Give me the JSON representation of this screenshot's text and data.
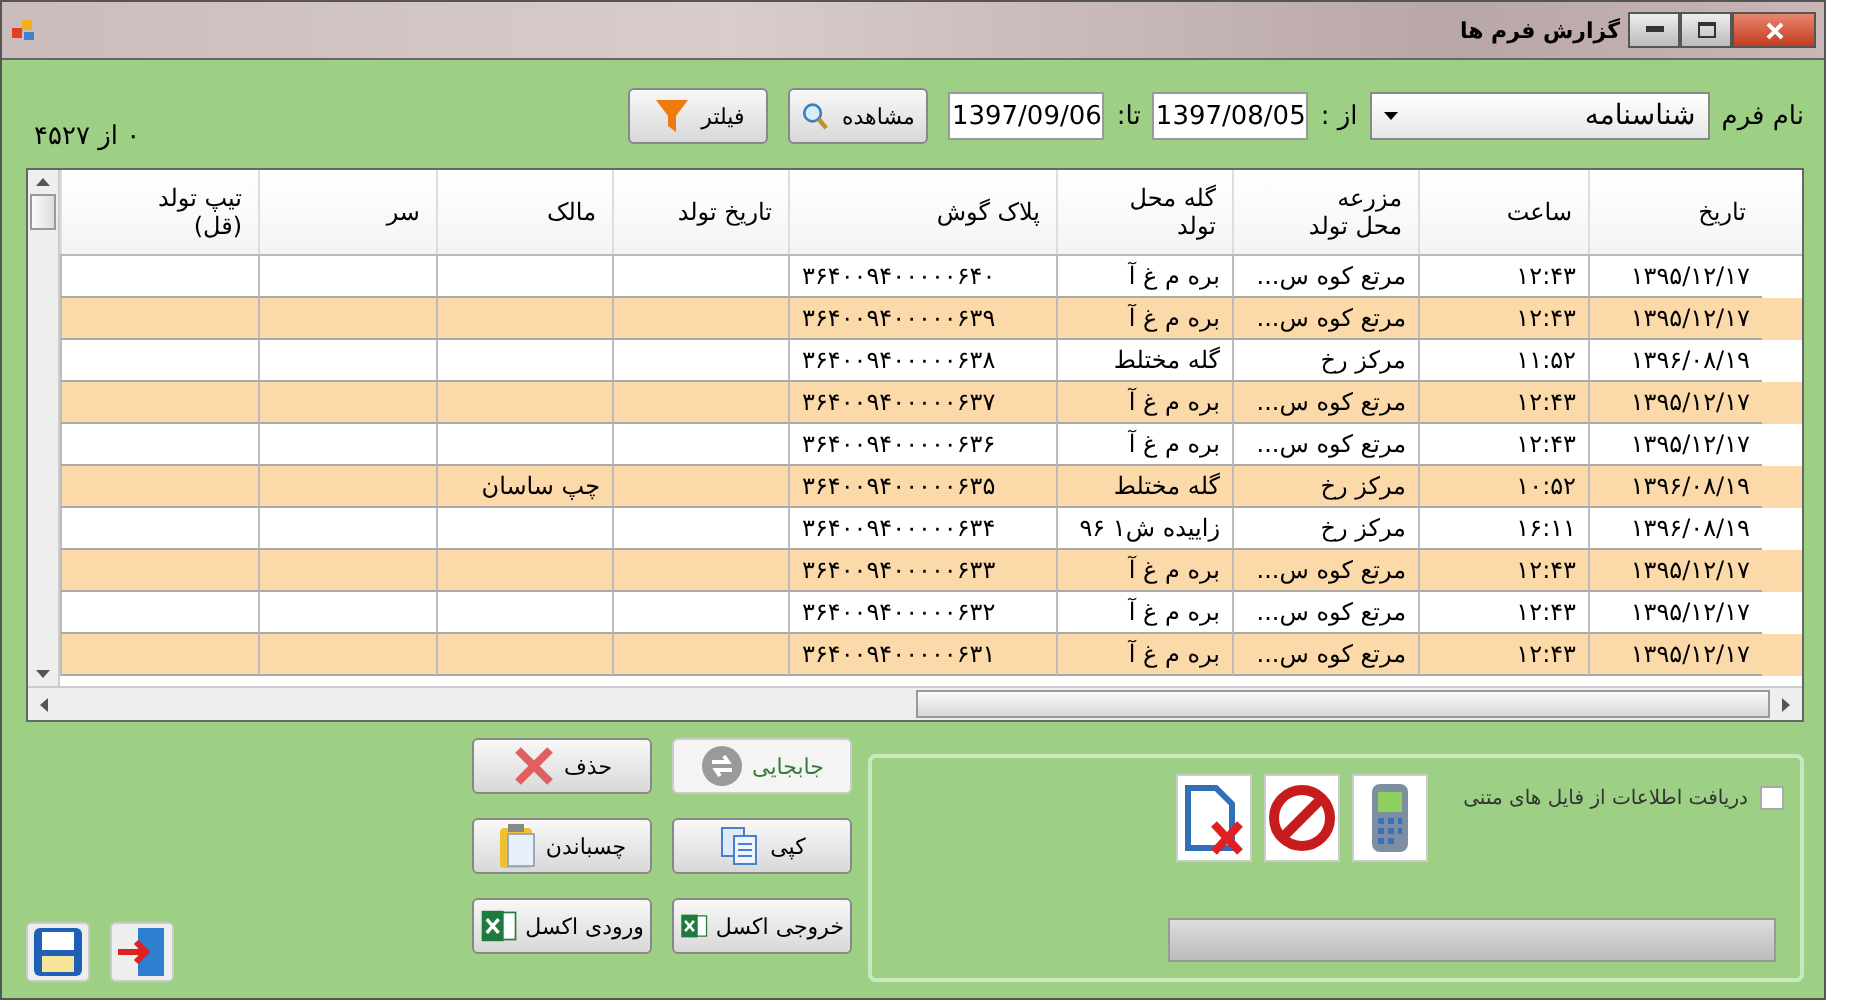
{
  "window": {
    "title": "گزارش فرم ها"
  },
  "filters": {
    "form_label": "نام فرم",
    "form_value": "شناسنامه",
    "from_label": "از :",
    "from_value": "1397/08/05",
    "to_label": "تا:",
    "to_value": "1397/09/06",
    "view_button": "مشاهده",
    "filter_button": "فیلتر",
    "count": "۰ از ۴۵۲۷"
  },
  "table": {
    "columns": [
      "تاریخ",
      "ساعت",
      "مزرعه\nمحل تولد",
      "گله محل\nتولد",
      "پلاک گوش",
      "تاریخ تولد",
      "مالک",
      "سر",
      "تیپ تولد\n(قل)"
    ],
    "rows": [
      [
        "۱۳۹۵/۱۲/۱۷",
        "۱۲:۴۳",
        "مرتع کوه س...",
        "بره م غ آ",
        "۳۶۴۰۰۹۴۰۰۰۰۰۶۴۰",
        "",
        "",
        "",
        ""
      ],
      [
        "۱۳۹۵/۱۲/۱۷",
        "۱۲:۴۳",
        "مرتع کوه س...",
        "بره م غ آ",
        "۳۶۴۰۰۹۴۰۰۰۰۰۶۳۹",
        "",
        "",
        "",
        ""
      ],
      [
        "۱۳۹۶/۰۸/۱۹",
        "۱۱:۵۲",
        "مرکز رخ",
        "گله مختلط",
        "۳۶۴۰۰۹۴۰۰۰۰۰۶۳۸",
        "",
        "",
        "",
        ""
      ],
      [
        "۱۳۹۵/۱۲/۱۷",
        "۱۲:۴۳",
        "مرتع کوه س...",
        "بره م غ آ",
        "۳۶۴۰۰۹۴۰۰۰۰۰۶۳۷",
        "",
        "",
        "",
        ""
      ],
      [
        "۱۳۹۵/۱۲/۱۷",
        "۱۲:۴۳",
        "مرتع کوه س...",
        "بره م غ آ",
        "۳۶۴۰۰۹۴۰۰۰۰۰۶۳۶",
        "",
        "",
        "",
        ""
      ],
      [
        "۱۳۹۶/۰۸/۱۹",
        "۱۰:۵۲",
        "مرکز رخ",
        "گله مختلط",
        "۳۶۴۰۰۹۴۰۰۰۰۰۶۳۵",
        "",
        "چپ ساسان",
        "",
        ""
      ],
      [
        "۱۳۹۶/۰۸/۱۹",
        "۱۶:۱۱",
        "مرکز رخ",
        "زاییده ش۱ ۹۶",
        "۳۶۴۰۰۹۴۰۰۰۰۰۶۳۴",
        "",
        "",
        "",
        ""
      ],
      [
        "۱۳۹۵/۱۲/۱۷",
        "۱۲:۴۳",
        "مرتع کوه س...",
        "بره م غ آ",
        "۳۶۴۰۰۹۴۰۰۰۰۰۶۳۳",
        "",
        "",
        "",
        ""
      ],
      [
        "۱۳۹۵/۱۲/۱۷",
        "۱۲:۴۳",
        "مرتع کوه س...",
        "بره م غ آ",
        "۳۶۴۰۰۹۴۰۰۰۰۰۶۳۲",
        "",
        "",
        "",
        ""
      ],
      [
        "۱۳۹۵/۱۲/۱۷",
        "۱۲:۴۳",
        "مرتع کوه س...",
        "بره م غ آ",
        "۳۶۴۰۰۹۴۰۰۰۰۰۶۳۱",
        "",
        "",
        "",
        ""
      ]
    ]
  },
  "actions": [
    {
      "label": "جابجایی",
      "kind": "move",
      "disabled": true
    },
    {
      "label": "حذف",
      "kind": "delete",
      "disabled": false
    },
    {
      "label": "کپی",
      "kind": "copy",
      "disabled": false
    },
    {
      "label": "چسباندن",
      "kind": "paste",
      "disabled": false
    },
    {
      "label": "خروجی اکسل",
      "kind": "excel",
      "disabled": false
    },
    {
      "label": "ورودی اکسل",
      "kind": "excel",
      "disabled": false
    }
  ],
  "import_panel": {
    "checkbox": {
      "label": "دریافت اطلاعات از فایل های متنی",
      "checked": false
    },
    "progress": {
      "level": 0
    }
  }
}
